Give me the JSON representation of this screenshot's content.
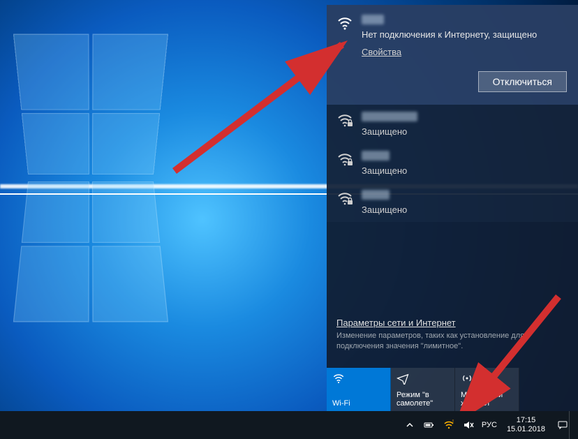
{
  "flyout": {
    "active": {
      "status": "Нет подключения к Интернету, защищено",
      "properties": "Свойства",
      "disconnect": "Отключиться"
    },
    "others": [
      {
        "status": "Защищено"
      },
      {
        "status": "Защищено"
      },
      {
        "status": "Защищено"
      }
    ],
    "settings": {
      "link": "Параметры сети и Интернет",
      "desc": "Изменение параметров, таких как установление для подключения значения \"лимитное\"."
    },
    "tiles": {
      "wifi": "Wi-Fi",
      "airplane": "Режим \"в самолете\"",
      "hotspot": "Мобильный хот-спот"
    }
  },
  "tray": {
    "lang": "РУС",
    "time": "17:15",
    "date": "15.01.2018"
  }
}
